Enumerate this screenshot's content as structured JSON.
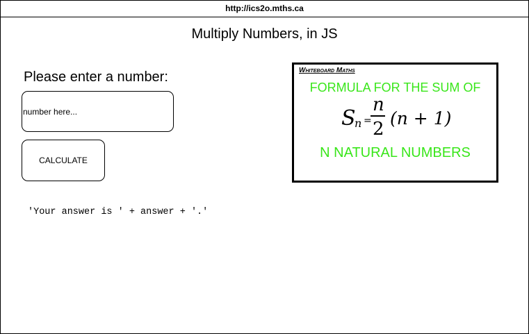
{
  "browser": {
    "url": "http://ics2o.mths.ca"
  },
  "page": {
    "title": "Multiply Numbers, in JS",
    "prompt": "Please enter a number:",
    "input_placeholder": "number here...",
    "button_label": "CALCULATE",
    "answer_text": "'Your answer is ' + answer + '.'"
  },
  "whiteboard": {
    "brand": "Whiteboard Maths",
    "line1": "FORMULA FOR THE SUM OF",
    "line2": "N NATURAL NUMBERS",
    "formula": {
      "s": "S",
      "sub": "n",
      "eq": "=",
      "num": "n",
      "den": "2",
      "tail": "(n + 1)"
    },
    "accent_color": "#39e61a"
  }
}
